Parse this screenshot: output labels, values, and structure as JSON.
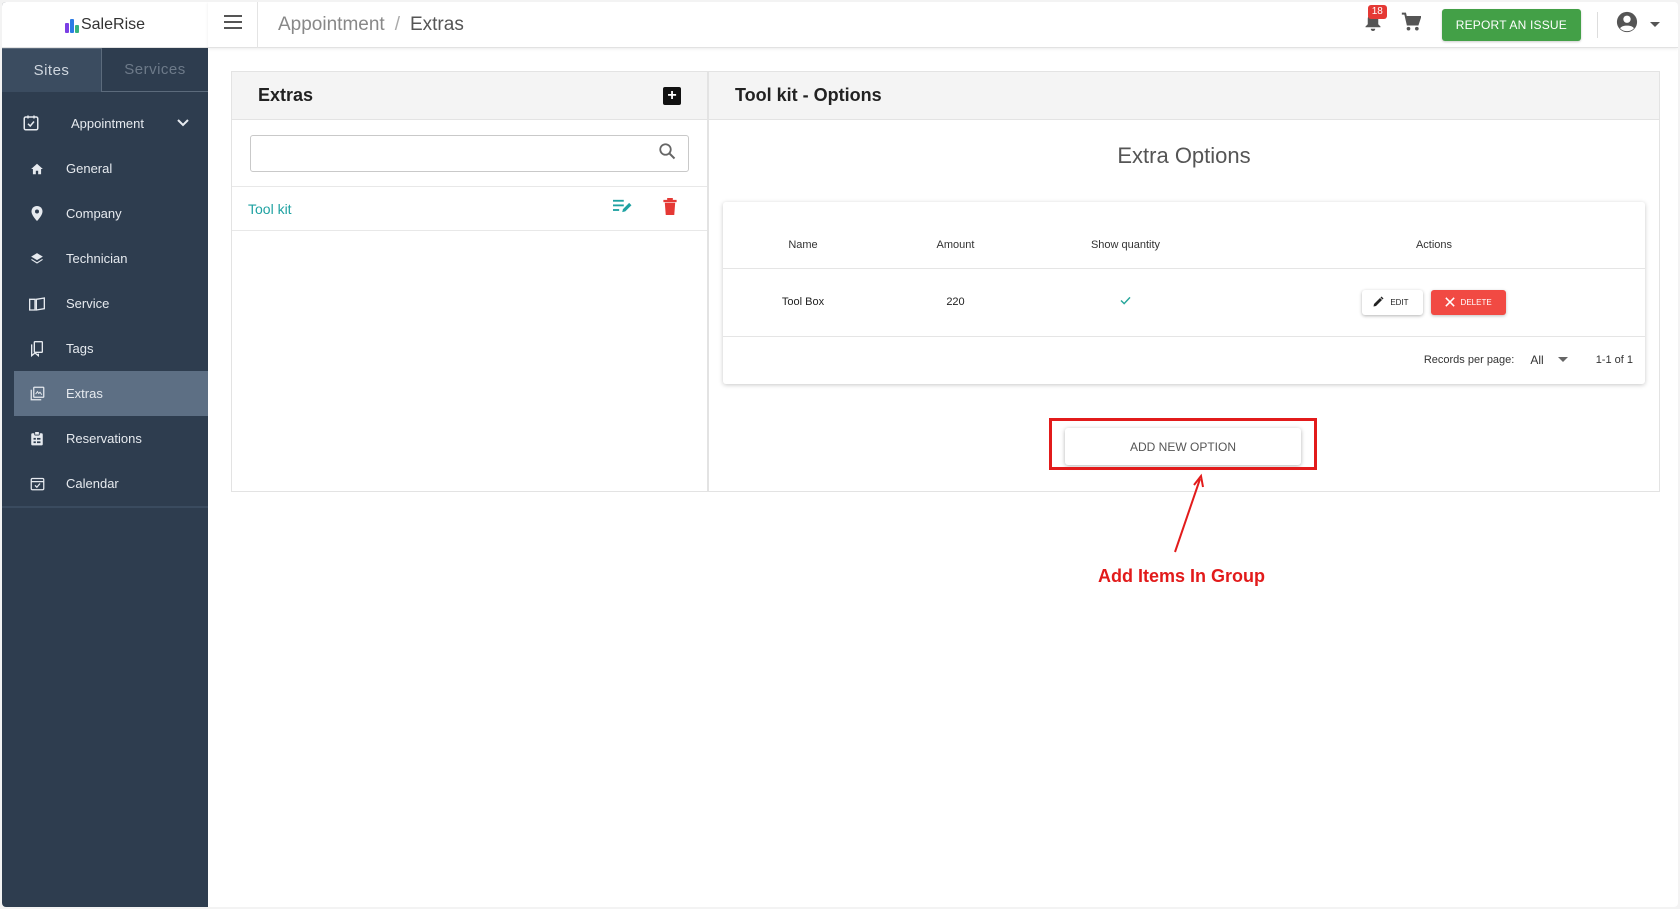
{
  "app": {
    "logo_text": "SaleRise"
  },
  "sidebar": {
    "tabs": [
      {
        "label": "Sites"
      },
      {
        "label": "Services"
      }
    ],
    "parent": {
      "label": "Appointment"
    },
    "items": [
      {
        "label": "General",
        "icon": "home-icon"
      },
      {
        "label": "Company",
        "icon": "map-pin-icon"
      },
      {
        "label": "Technician",
        "icon": "layers-icon"
      },
      {
        "label": "Service",
        "icon": "book-icon"
      },
      {
        "label": "Tags",
        "icon": "tag-icon"
      },
      {
        "label": "Extras",
        "icon": "extras-icon",
        "active": true
      },
      {
        "label": "Reservations",
        "icon": "clipboard-icon"
      },
      {
        "label": "Calendar",
        "icon": "calendar-icon"
      }
    ]
  },
  "header": {
    "breadcrumb": [
      "Appointment",
      "Extras"
    ],
    "separator": "/",
    "notifications_count": "18",
    "report_label": "REPORT AN ISSUE"
  },
  "extras_panel": {
    "title": "Extras",
    "search": {
      "value": "",
      "placeholder": ""
    },
    "items": [
      {
        "name": "Tool kit"
      }
    ]
  },
  "options_panel": {
    "title": "Tool kit - Options",
    "section_title": "Extra Options",
    "table": {
      "columns": [
        "Name",
        "Amount",
        "Show quantity",
        "Actions"
      ],
      "rows": [
        {
          "name": "Tool Box",
          "amount": "220",
          "show_quantity": true
        }
      ],
      "edit_label": "EDIT",
      "delete_label": "DELETE"
    },
    "pager": {
      "records_label": "Records per page:",
      "records_value": "All",
      "range": "1-1 of 1"
    },
    "add_button": "ADD NEW OPTION"
  },
  "annotation": {
    "text": "Add Items In Group"
  },
  "colors": {
    "sidebar_bg": "#2e3d4f",
    "accent_teal": "#1fa2a2",
    "report_green": "#43a047",
    "delete_red": "#f14a43",
    "annotation_red": "#e21b1b"
  }
}
